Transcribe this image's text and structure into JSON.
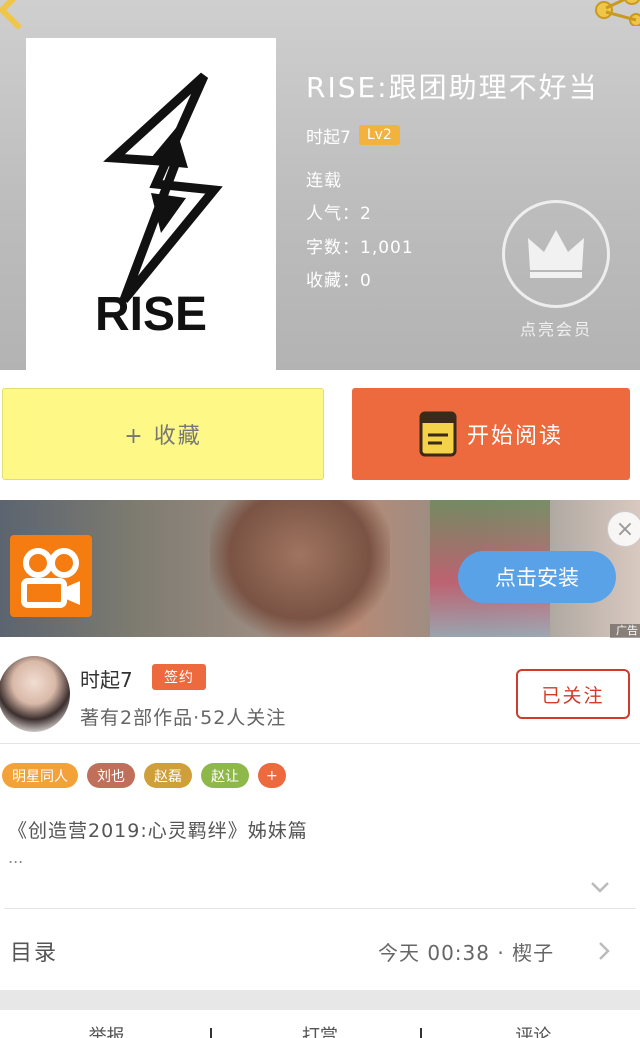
{
  "book": {
    "title": "RISE:跟团助理不好当",
    "cover_text": "RISE",
    "author": "时起7",
    "level": "Lv2",
    "status": "连载",
    "popularity": "人气：2",
    "word_count": "字数：1,001",
    "favorites": "收藏：0",
    "vip_label": "点亮会员"
  },
  "actions": {
    "favorite_label": "+ 收藏",
    "read_label": "开始阅读"
  },
  "ad": {
    "install_label": "点击安装",
    "close_symbol": "×",
    "ad_tag": "广告"
  },
  "author_section": {
    "name": "时起7",
    "badge": "签约",
    "subtitle": "著有2部作品·52人关注",
    "follow_label": "已关注"
  },
  "tags": [
    {
      "label": "明星同人",
      "color": "#f3a23a"
    },
    {
      "label": "刘也",
      "color": "#c0705a"
    },
    {
      "label": "赵磊",
      "color": "#cf9f3a"
    },
    {
      "label": "赵让",
      "color": "#8fb84a"
    },
    {
      "label": "+",
      "color": "#ec6a3e"
    }
  ],
  "description": {
    "text": "《创造营2019:心灵羁绊》姊妹篇",
    "more": "..."
  },
  "toc": {
    "label": "目录",
    "latest": "今天 00:38 · 楔子"
  },
  "bottom_nav": [
    "举报",
    "打赏",
    "评论"
  ],
  "colors": {
    "accent_orange": "#ec6a3e",
    "favorite_yellow": "#fef987",
    "install_blue": "#5aa2e8",
    "follow_red": "#d23b2a"
  }
}
